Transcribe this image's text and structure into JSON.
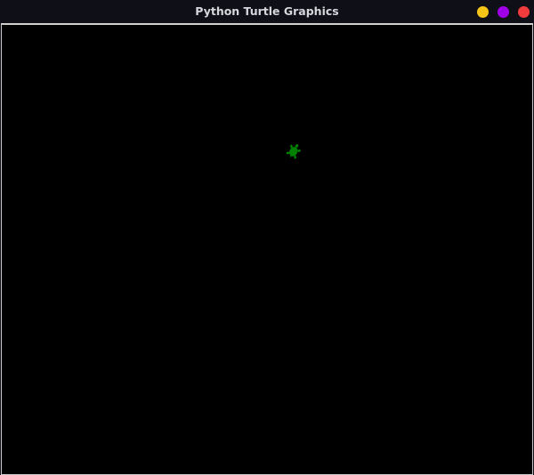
{
  "window": {
    "title": "Python Turtle Graphics",
    "buttons": [
      {
        "name": "minimize",
        "color": "#f5c518"
      },
      {
        "name": "maximize",
        "color": "#a000e8"
      },
      {
        "name": "close",
        "color": "#f03c3c"
      }
    ]
  },
  "canvas": {
    "background": "#000000",
    "turtle": {
      "shape": "turtle",
      "color": "#008000"
    }
  }
}
